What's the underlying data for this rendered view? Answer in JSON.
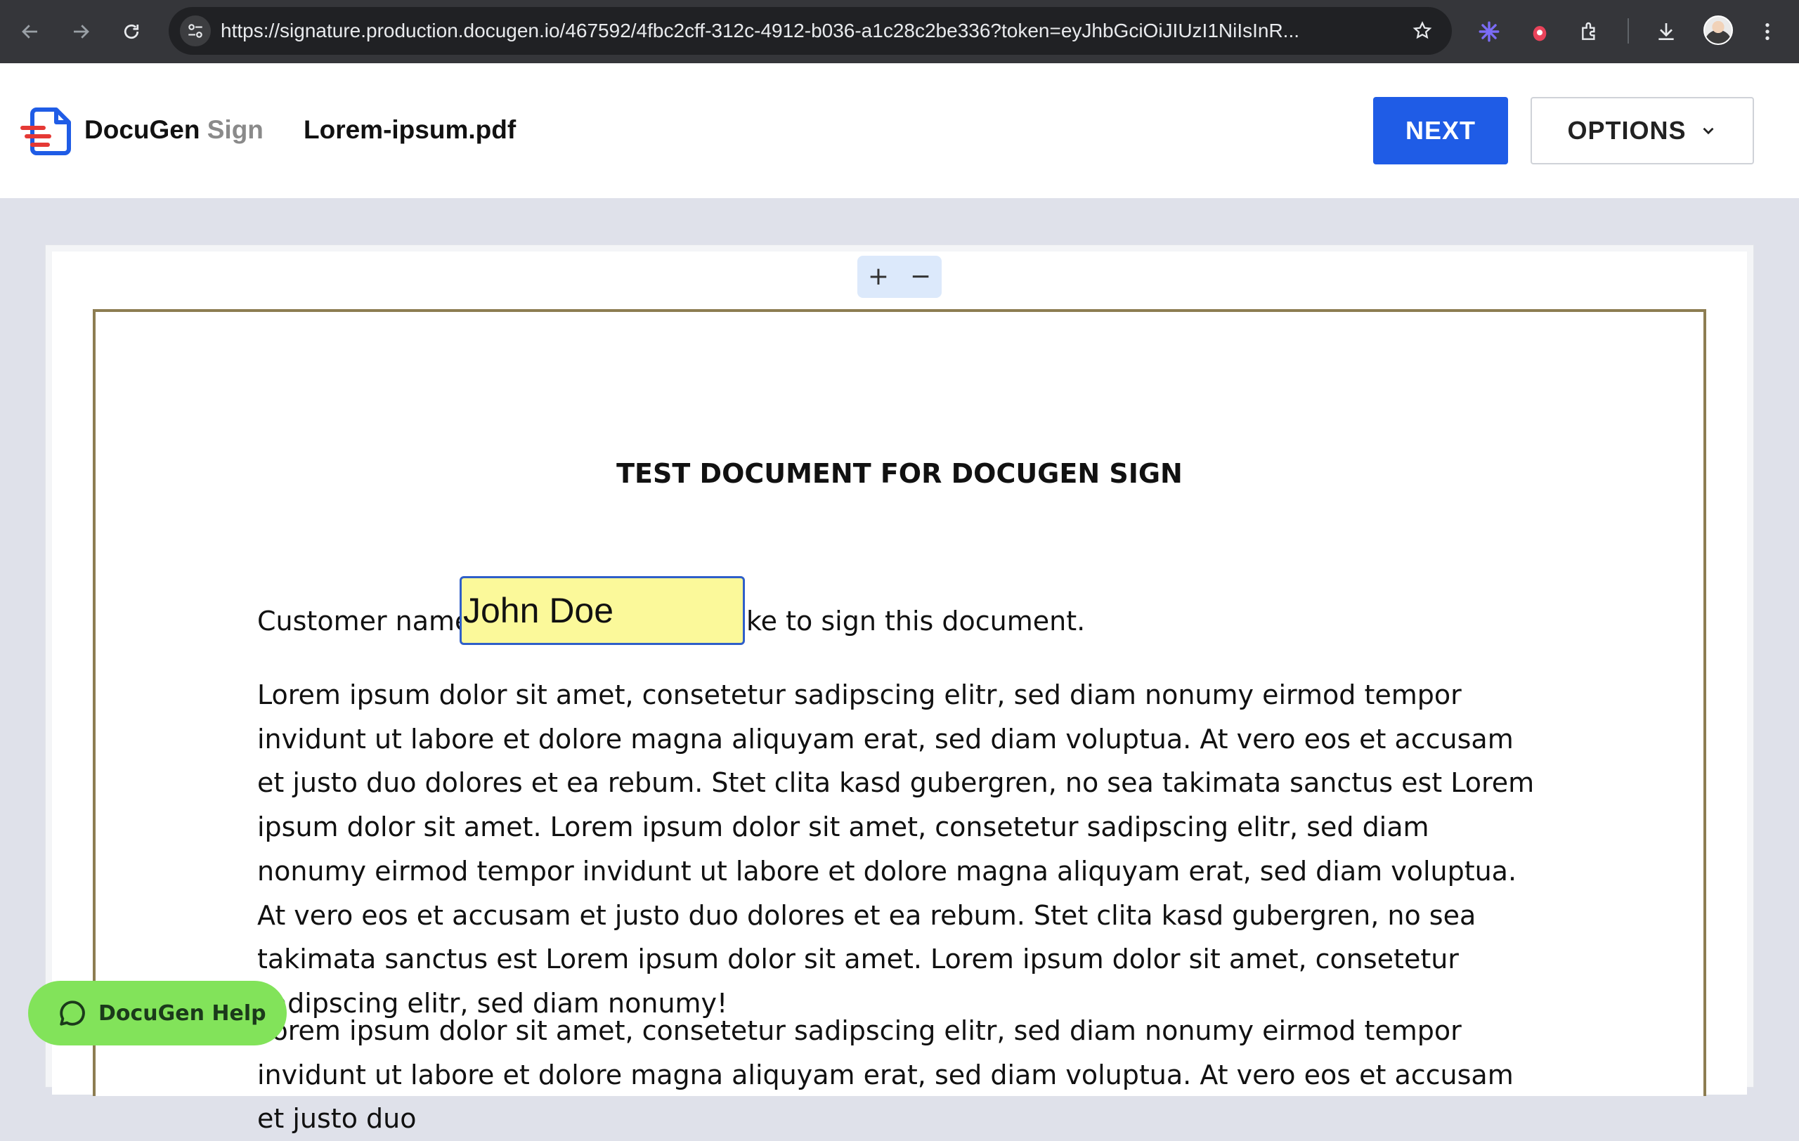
{
  "browser": {
    "url": "https://signature.production.docugen.io/467592/4fbc2cff-312c-4912-b036-a1c28c2be336?token=eyJhbGciOiJIUzI1NiIsInR...",
    "icons": [
      "back-icon",
      "forward-icon",
      "reload-icon",
      "site-settings-icon",
      "bookmark-star-icon",
      "extension-sparkle-icon",
      "extension-bug-icon",
      "extensions-puzzle-icon",
      "download-icon",
      "profile-avatar",
      "menu-kebab-icon"
    ]
  },
  "header": {
    "brand_main": "DocuGen",
    "brand_sub": "Sign",
    "filename": "Lorem-ipsum.pdf",
    "next_label": "NEXT",
    "options_label": "OPTIONS"
  },
  "zoom": {
    "plus": "+",
    "minus": "−"
  },
  "document": {
    "title": "TEST DOCUMENT FOR DOCUGEN SIGN",
    "line1_before": "Customer name",
    "line1_after": "ke to sign this document.",
    "name_value": "John Doe",
    "paragraph1": "Lorem ipsum dolor sit amet, consetetur sadipscing elitr, sed diam nonumy eirmod tempor invidunt ut labore et dolore magna aliquyam erat, sed diam voluptua. At vero eos et accusam et justo duo dolores et ea rebum. Stet clita kasd gubergren, no sea takimata sanctus est Lorem ipsum dolor sit amet. Lorem ipsum dolor sit amet, consetetur sadipscing elitr, sed diam nonumy eirmod tempor invidunt ut labore et dolore magna aliquyam erat, sed diam voluptua. At vero eos et accusam et justo duo dolores et ea rebum. Stet clita kasd gubergren, no sea takimata sanctus est Lorem ipsum dolor sit amet. Lorem ipsum dolor sit amet, consetetur sadipscing elitr, sed diam nonumy!",
    "paragraph2": "Lorem ipsum dolor sit amet, consetetur sadipscing elitr, sed diam nonumy eirmod tempor invidunt ut labore et dolore magna aliquyam erat, sed diam voluptua. At vero eos et accusam et justo duo"
  },
  "help": {
    "label": "DocuGen Help"
  },
  "colors": {
    "primary": "#1f5ce6",
    "field_bg": "#fbf99a",
    "field_border": "#2f5fc9",
    "page_border": "#8d7d52",
    "help_bg": "#82e35a",
    "background": "#dfe1ea"
  }
}
